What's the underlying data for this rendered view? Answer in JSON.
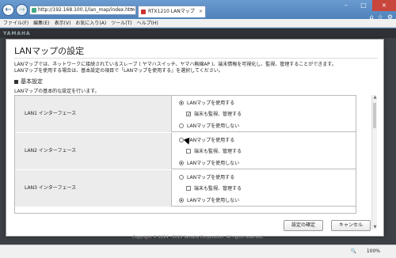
{
  "browser": {
    "url": "http://192.168.100.1/lan_map/index.htm",
    "tab_title": "RTX1210 LANマップ",
    "menu": [
      "ファイル(F)",
      "編集(E)",
      "表示(V)",
      "お気に入り(A)",
      "ツール(T)",
      "ヘルプ(H)"
    ],
    "zoom": "100%"
  },
  "page": {
    "footer": "Copyright © 2014 - 2015 Yamaha Corporation. All rights reserved."
  },
  "dialog": {
    "title": "LANマップの設定",
    "intro_line1": "LANマップでは、ネットワークに接続されているスレーブ ( ヤマハスイッチ、ヤマハ無線AP )、端末情報を可視化し、監視、管理することができます。",
    "intro_line2": "LANマップを使用する場合は、基本設定の項目で「LANマップを使用する」を選択してください。",
    "section_title": "基本設定",
    "section_desc": "LANマップの基本的な設定を行います。",
    "rows": [
      {
        "label": "LAN1 インターフェース",
        "opt_use": "LANマップを使用する",
        "opt_monitor": "端末も監視、管理する",
        "opt_nouse": "LANマップを使用しない",
        "use_selected": true,
        "monitor_checked": true
      },
      {
        "label": "LAN2 インターフェース",
        "opt_use": "LANマップを使用する",
        "opt_monitor": "端末も監視、管理する",
        "opt_nouse": "LANマップを使用しない",
        "use_selected": false,
        "monitor_checked": false
      },
      {
        "label": "LAN3 インターフェース",
        "opt_use": "LANマップを使用する",
        "opt_monitor": "端末も監視、管理する",
        "opt_nouse": "LANマップを使用しない",
        "use_selected": false,
        "monitor_checked": false
      }
    ],
    "apply_label": "設定の確定",
    "cancel_label": "キャンセル"
  }
}
